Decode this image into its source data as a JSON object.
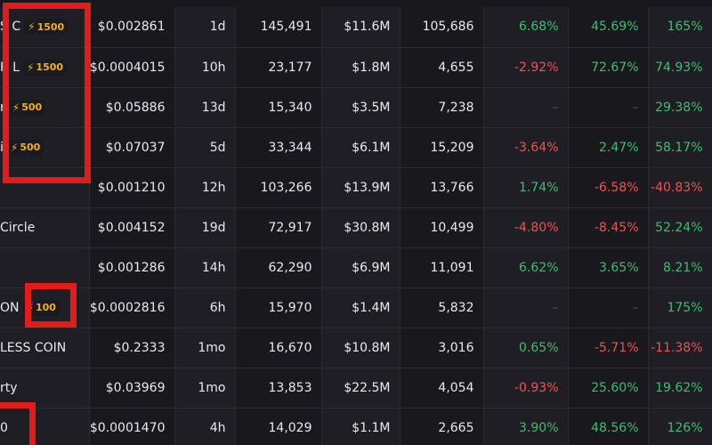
{
  "colors": {
    "positive": "#3fbd72",
    "negative": "#ef5350",
    "boost": "#f2b01e",
    "highlight": "#e21b1b"
  },
  "rows": [
    {
      "name": "S C",
      "boost": "1500",
      "price": "$0.002861",
      "age": "1d",
      "txns": "145,491",
      "volume": "$11.6M",
      "makers": "105,686",
      "c1": "6.68%",
      "c2": "45.69%",
      "c3": "165%",
      "s1": "pos",
      "s2": "pos",
      "s3": "pos"
    },
    {
      "name": "R L",
      "boost": "1500",
      "price": "$0.0004015",
      "age": "10h",
      "txns": "23,177",
      "volume": "$1.8M",
      "makers": "4,655",
      "c1": "-2.92%",
      "c2": "72.67%",
      "c3": "74.93%",
      "s1": "neg",
      "s2": "pos",
      "s3": "pos"
    },
    {
      "name": "r",
      "boost": "500",
      "price": "$0.05886",
      "age": "13d",
      "txns": "15,340",
      "volume": "$3.5M",
      "makers": "7,238",
      "c1": "–",
      "c2": "–",
      "c3": "29.38%",
      "s1": "dash",
      "s2": "dash",
      "s3": "pos"
    },
    {
      "name": "i",
      "boost": "500",
      "price": "$0.07037",
      "age": "5d",
      "txns": "33,344",
      "volume": "$6.1M",
      "makers": "15,209",
      "c1": "-3.64%",
      "c2": "2.47%",
      "c3": "58.17%",
      "s1": "neg",
      "s2": "pos",
      "s3": "pos"
    },
    {
      "name": "",
      "boost": "",
      "price": "$0.001210",
      "age": "12h",
      "txns": "103,266",
      "volume": "$13.9M",
      "makers": "13,766",
      "c1": "1.74%",
      "c2": "-6.58%",
      "c3": "-40.83%",
      "s1": "pos",
      "s2": "neg",
      "s3": "neg"
    },
    {
      "name": "Circle",
      "boost": "",
      "price": "$0.004152",
      "age": "19d",
      "txns": "72,917",
      "volume": "$30.8M",
      "makers": "10,499",
      "c1": "-4.80%",
      "c2": "-8.45%",
      "c3": "52.24%",
      "s1": "neg",
      "s2": "neg",
      "s3": "pos"
    },
    {
      "name": "",
      "boost": "",
      "price": "$0.001286",
      "age": "14h",
      "txns": "62,290",
      "volume": "$6.9M",
      "makers": "11,091",
      "c1": "6.62%",
      "c2": "3.65%",
      "c3": "8.21%",
      "s1": "pos",
      "s2": "pos",
      "s3": "pos"
    },
    {
      "name": "ON",
      "boost": "100",
      "price": "$0.0002816",
      "age": "6h",
      "txns": "15,970",
      "volume": "$1.4M",
      "makers": "5,832",
      "c1": "–",
      "c2": "–",
      "c3": "175%",
      "s1": "dash",
      "s2": "dash",
      "s3": "pos"
    },
    {
      "name": "LESS COIN",
      "boost": "",
      "price": "$0.2333",
      "age": "1mo",
      "txns": "16,670",
      "volume": "$10.8M",
      "makers": "3,016",
      "c1": "0.65%",
      "c2": "-5.71%",
      "c3": "-11.38%",
      "s1": "pos",
      "s2": "neg",
      "s3": "neg"
    },
    {
      "name": "rty",
      "boost": "",
      "price": "$0.03969",
      "age": "1mo",
      "txns": "13,853",
      "volume": "$22.5M",
      "makers": "4,054",
      "c1": "-0.93%",
      "c2": "25.60%",
      "c3": "19.62%",
      "s1": "neg",
      "s2": "pos",
      "s3": "pos"
    },
    {
      "name": "0",
      "boost": "",
      "price": "$0.0001470",
      "age": "4h",
      "txns": "14,029",
      "volume": "$1.1M",
      "makers": "2,665",
      "c1": "3.90%",
      "c2": "48.56%",
      "c3": "126%",
      "s1": "pos",
      "s2": "pos",
      "s3": "pos"
    }
  ]
}
